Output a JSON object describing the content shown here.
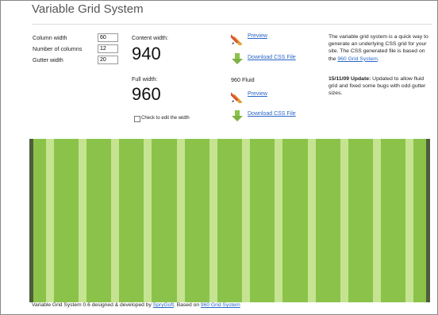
{
  "header": {
    "title": "Variable Grid System"
  },
  "form": {
    "column_width_label": "Column width",
    "column_width_value": "60",
    "num_columns_label": "Number of columns",
    "num_columns_value": "12",
    "gutter_width_label": "Gutter width",
    "gutter_width_value": "20"
  },
  "content": {
    "content_width_label": "Content width:",
    "content_width_value": "940",
    "full_width_label": "Full width:",
    "full_width_value": "960",
    "checkbox_label": "Check to edit the width"
  },
  "actions": {
    "preview_label": "Preview",
    "download_label": "Download CSS File",
    "fluid_heading": "960 Fluid",
    "preview2_label": "Preview",
    "download2_label": "Download CSS File"
  },
  "aside": {
    "intro": "The variable grid system is a quick way to generate an underlying CSS grid for your site. The CSS generated file is based on the",
    "intro_link": "960 Grid System",
    "intro_end": ".",
    "update_label": "15/11/09 Update:",
    "update_text": "Updated to allow fluid grid and fixed some bugs with odd gutter sizes."
  },
  "grid_preview": {
    "columns": 12,
    "gutter_color": "#c6e392",
    "column_color": "#8bc34a",
    "edge_color": "#4e5d3a"
  },
  "footer": {
    "text_before": "Variable Grid System 0.6 designed & developed by",
    "author_link": "SpryGoft",
    "text_middle": ". Based on",
    "grid_link": "960 Grid System"
  }
}
